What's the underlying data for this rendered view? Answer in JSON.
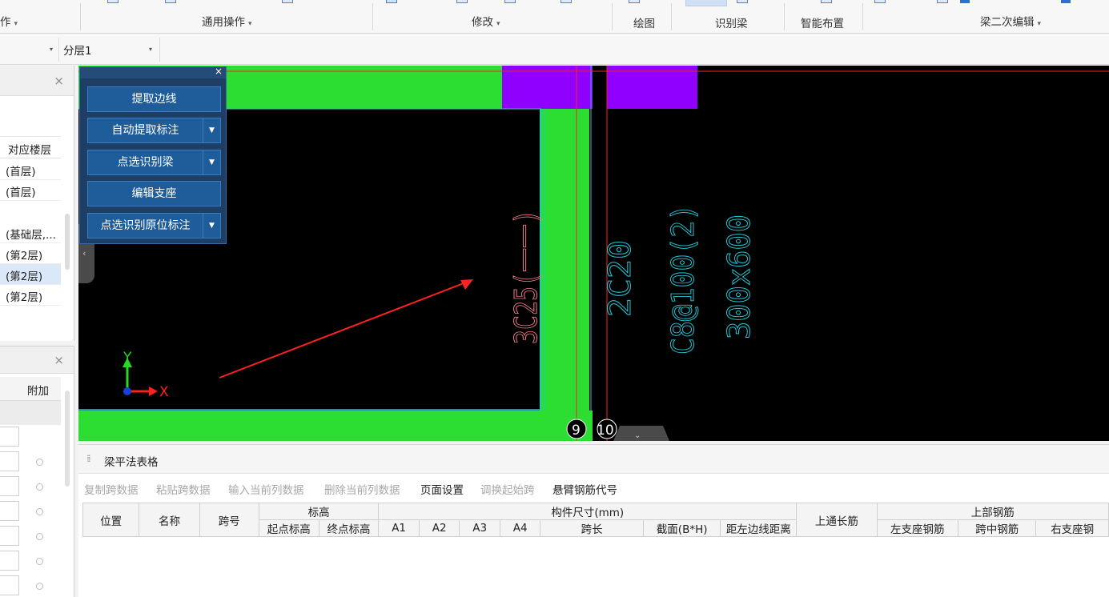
{
  "ribbon": {
    "groups": [
      {
        "label": "作",
        "caret": "▾"
      },
      {
        "label": "通用操作",
        "caret": "▾"
      },
      {
        "label": "修改",
        "caret": "▾"
      },
      {
        "label": "绘图",
        "caret": ""
      },
      {
        "label": "识别梁",
        "caret": ""
      },
      {
        "label": "智能布置",
        "caret": ""
      },
      {
        "label": "梁二次编辑",
        "caret": "▾"
      }
    ]
  },
  "toolbar2": {
    "dropdown1_caret": "▾",
    "layer_value": "分层1",
    "layer_caret": "▾"
  },
  "left_panel": {
    "close": "×",
    "col_header": "对应楼层",
    "rows": [
      {
        "text": "(首层)",
        "selected": false
      },
      {
        "text": "(首层)",
        "selected": false
      },
      {
        "text": "(基础层,...",
        "selected": false
      },
      {
        "text": "(第2层)",
        "selected": false
      },
      {
        "text": "(第2层)",
        "selected": true
      },
      {
        "text": "(第2层)",
        "selected": false
      }
    ]
  },
  "props_panel": {
    "close": "×",
    "col_header": "附加"
  },
  "canvas": {
    "annotations": {
      "rebar_bottom": "3C25(一一)",
      "rebar_top": "2C20",
      "stirrup": "C8@100(2)",
      "section": "300x600"
    },
    "axis_labels": {
      "x": "X",
      "y": "Y"
    },
    "grid_markers": [
      "9",
      "10"
    ],
    "colors": {
      "background": "#000000",
      "beam_fill": "#2bde31",
      "column_fill": "#8f00ff",
      "cyan_text": "#22c7d6",
      "pink_text": "#f07a8a",
      "red_line": "#ff2020"
    }
  },
  "float_panel": {
    "close": "×",
    "buttons": [
      {
        "label": "提取边线",
        "has_drop": false
      },
      {
        "label": "自动提取标注",
        "has_drop": true
      },
      {
        "label": "点选识别梁",
        "has_drop": true
      },
      {
        "label": "编辑支座",
        "has_drop": false
      },
      {
        "label": "点选识别原位标注",
        "has_drop": true
      }
    ],
    "drop_arrow": "▼"
  },
  "bottom_panel": {
    "title": "梁平法表格",
    "toolbar": [
      {
        "label": "复制跨数据",
        "enabled": false
      },
      {
        "label": "粘贴跨数据",
        "enabled": false
      },
      {
        "label": "输入当前列数据",
        "enabled": false
      },
      {
        "label": "删除当前列数据",
        "enabled": false
      },
      {
        "label": "页面设置",
        "enabled": true
      },
      {
        "label": "调换起始跨",
        "enabled": false
      },
      {
        "label": "悬臂钢筋代号",
        "enabled": true
      }
    ],
    "table": {
      "position": "位置",
      "name": "名称",
      "span_no": "跨号",
      "elevation": "标高",
      "start_elev": "起点标高",
      "end_elev": "终点标高",
      "dims": "构件尺寸(mm)",
      "a1": "A1",
      "a2": "A2",
      "a3": "A3",
      "a4": "A4",
      "span_len": "跨长",
      "section": "截面(B*H)",
      "edge_dist": "距左边线距离",
      "top_through": "上通长筋",
      "top_rebar": "上部钢筋",
      "left_support": "左支座钢筋",
      "mid_span": "跨中钢筋",
      "right_support": "右支座钢"
    }
  }
}
